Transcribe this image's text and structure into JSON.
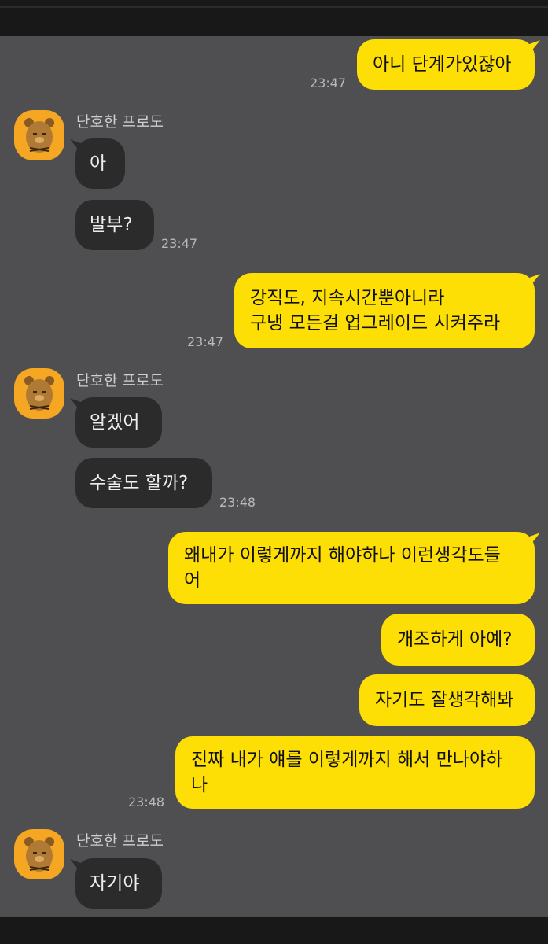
{
  "chat": {
    "messages": [
      {
        "side": "out",
        "text": "아니 단계가있잖아",
        "time": "23:47"
      },
      {
        "side": "in",
        "sender": "단호한 프로도",
        "text": "아"
      },
      {
        "side": "in",
        "text": "발부?",
        "time": "23:47"
      },
      {
        "side": "out",
        "text": "강직도, 지속시간뿐아니라\n구냉 모든걸 업그레이드 시켜주라",
        "time": "23:47"
      },
      {
        "side": "in",
        "sender": "단호한 프로도",
        "text": "알겠어"
      },
      {
        "side": "in",
        "text": "수술도 할까?",
        "time": "23:48"
      },
      {
        "side": "out",
        "text": "왜내가 이렇게까지 해야하나 이런생각도들\n어"
      },
      {
        "side": "out",
        "text": "개조하게 아예?"
      },
      {
        "side": "out",
        "text": "자기도 잘생각해봐"
      },
      {
        "side": "out",
        "text": "진짜 내가 얘를 이렇게까지 해서 만나야하\n나",
        "time": "23:48"
      },
      {
        "side": "in",
        "sender": "단호한 프로도",
        "text": "자기야"
      }
    ]
  },
  "avatar_icon": "bear-character-icon",
  "colors": {
    "background": "#4f4f51",
    "outgoing": "#fdde05",
    "incoming": "#2b2b2b",
    "avatar": "#f5a623"
  }
}
